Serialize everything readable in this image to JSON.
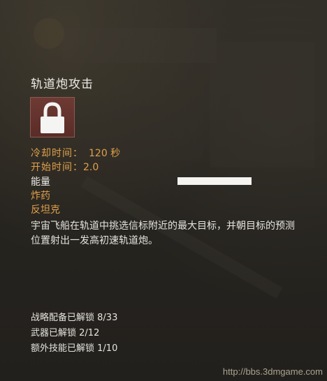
{
  "ability": {
    "title": "轨道炮攻击",
    "icon": "lock-icon",
    "cooldown_label": "冷却时间：",
    "cooldown_value": "120 秒",
    "start_label": "开始时间：",
    "start_value": "2.0",
    "energy_label": "能量",
    "energy_level": 1.0,
    "items": [
      "炸药",
      "反坦克"
    ],
    "description": "宇宙飞船在轨道中挑选信标附近的最大目标，并朝目标的预测位置射出一发高初速轨道炮。"
  },
  "unlocks": {
    "strategic_label": "战略配备已解锁",
    "strategic_value": "8/33",
    "weapons_label": "武器已解锁",
    "weapons_value": "2/12",
    "extra_label": "额外技能已解锁",
    "extra_value": "1/10"
  },
  "watermark": "http://bbs.3dmgame.com",
  "colors": {
    "accent": "#e0a04a",
    "text": "#ecebe6",
    "icon_bg": "#6e3a33"
  }
}
